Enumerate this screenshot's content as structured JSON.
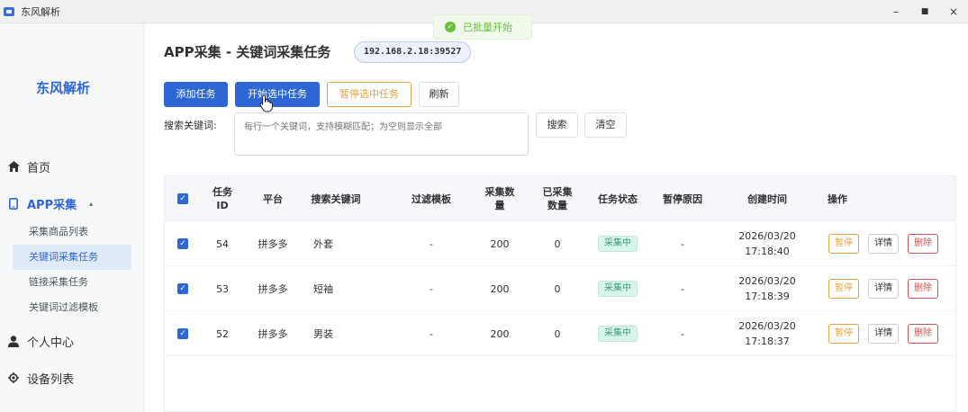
{
  "window": {
    "title": "东风解析",
    "controls": {
      "minimize": "–",
      "maximize": "■",
      "close": "×"
    }
  },
  "toast": {
    "message": "已批量开始",
    "icon": "check-circle-icon",
    "color": "#67c23a"
  },
  "sidebar": {
    "brand": "东风解析",
    "items": [
      {
        "label": "首页",
        "icon": "home-icon"
      },
      {
        "label": "APP采集",
        "icon": "phone-icon",
        "expanded": true,
        "caret": "▴",
        "children": [
          {
            "label": "采集商品列表"
          },
          {
            "label": "关键词采集任务",
            "active": true
          },
          {
            "label": "链接采集任务"
          },
          {
            "label": "关键词过滤模板"
          }
        ]
      },
      {
        "label": "个人中心",
        "icon": "user-icon"
      },
      {
        "label": "设备列表",
        "icon": "device-icon"
      }
    ]
  },
  "page": {
    "title": "APP采集 - 关键词采集任务",
    "device_ip": "192.168.2.18:39527"
  },
  "toolbar": {
    "add": "添加任务",
    "start_selected": "开始选中任务",
    "pause_selected": "暂停选中任务",
    "refresh": "刷新"
  },
  "search": {
    "label": "搜索关键词:",
    "placeholder": "每行一个关键词，支持模糊匹配；为空则显示全部",
    "search_button": "搜索",
    "clear_button": "清空"
  },
  "table": {
    "columns": [
      "任务ID",
      "平台",
      "搜索关键词",
      "过滤模板",
      "采集数量",
      "已采集数量",
      "任务状态",
      "暂停原因",
      "创建时间",
      "操作"
    ],
    "column_display": [
      "任务\nID",
      "平台",
      "搜索关键词",
      "过滤模板",
      "采集数\n量",
      "已采集\n数量",
      "任务状态",
      "暂停原因",
      "创建时间",
      "操作"
    ],
    "rows": [
      {
        "checked": true,
        "id": "54",
        "platform": "拼多多",
        "keyword": "外套",
        "template": "-",
        "target": "200",
        "collected": "0",
        "status": "采集中",
        "pause_reason": "-",
        "created_date": "2026/03/20",
        "created_time": "17:18:40"
      },
      {
        "checked": true,
        "id": "53",
        "platform": "拼多多",
        "keyword": "短袖",
        "template": "-",
        "target": "200",
        "collected": "0",
        "status": "采集中",
        "pause_reason": "-",
        "created_date": "2026/03/20",
        "created_time": "17:18:39"
      },
      {
        "checked": true,
        "id": "52",
        "platform": "拼多多",
        "keyword": "男装",
        "template": "-",
        "target": "200",
        "collected": "0",
        "status": "采集中",
        "pause_reason": "-",
        "created_date": "2026/03/20",
        "created_time": "17:18:37"
      }
    ],
    "row_actions": {
      "pause": "暂停",
      "detail": "详情",
      "delete": "删除"
    }
  },
  "colors": {
    "primary": "#2e66d6",
    "warning": "#e6a23c",
    "danger": "#c45656",
    "status_bg": "#d9f4ec",
    "status_text": "#3a9c7d"
  }
}
